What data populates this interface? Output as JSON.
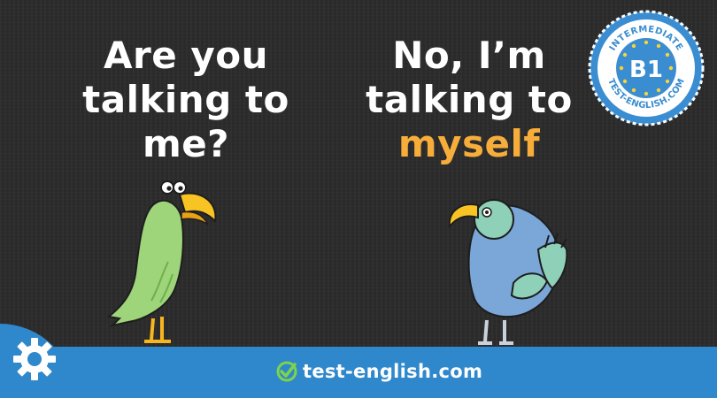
{
  "speech_left": {
    "lines": [
      "Are you",
      "talking to",
      "me?"
    ]
  },
  "speech_right": {
    "lines": [
      "No, I’m",
      "talking to"
    ],
    "highlight_word": "myself"
  },
  "badge": {
    "top_text": "INTERMEDIATE",
    "level": "B1",
    "bottom_text": "TEST-ENGLISH.COM"
  },
  "footer": {
    "brand": "test-english.com",
    "icons": [
      "gear-icon",
      "check-icon"
    ]
  },
  "colors": {
    "background": "#2c2c2c",
    "footer": "#2f88cc",
    "highlight": "#f7ad3a",
    "green_parrot": "#9ed47a",
    "blue_parrot": "#7aa6d8",
    "badge_accent": "#3a8dd0"
  }
}
